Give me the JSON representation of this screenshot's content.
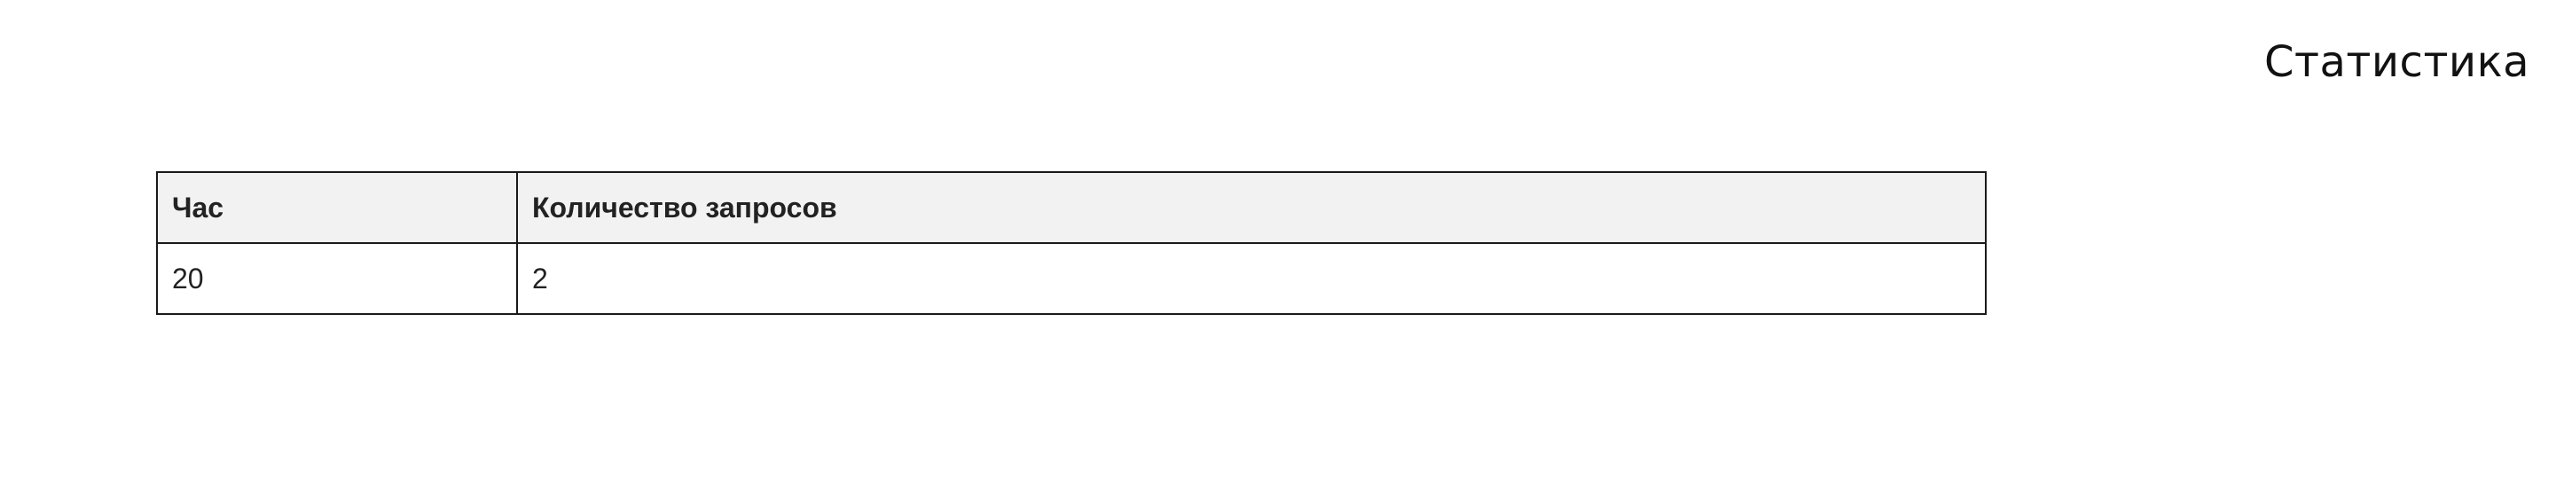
{
  "page": {
    "title": "Статистика"
  },
  "table": {
    "headers": [
      "Час",
      "Количество запросов"
    ],
    "rows": [
      [
        "20",
        "2"
      ]
    ]
  },
  "colors": {
    "header_background": "#f2f2f2",
    "border": "#1a1a1a",
    "text": "#111111"
  }
}
